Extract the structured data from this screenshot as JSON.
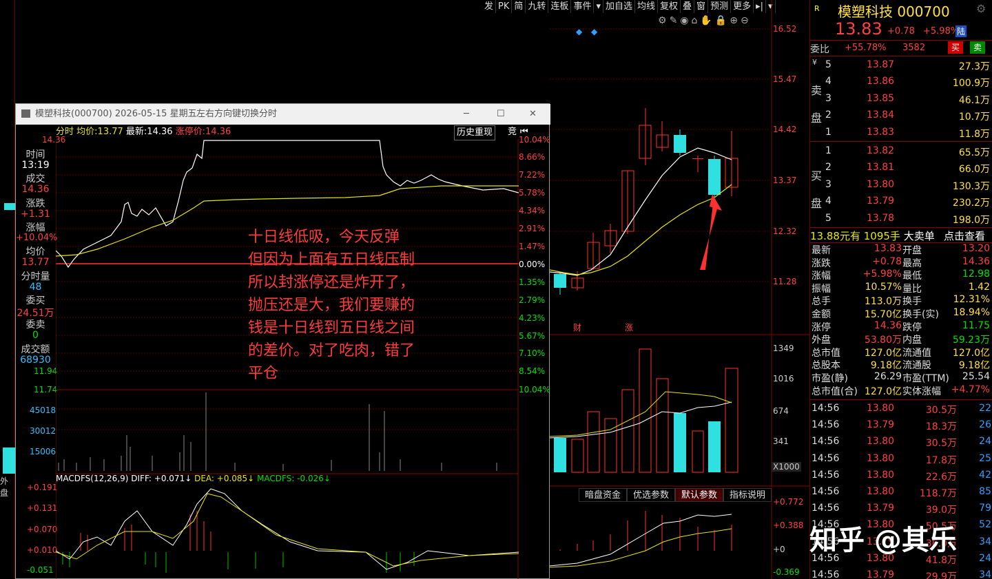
{
  "toolbar": {
    "items": [
      "发",
      "PK",
      "简",
      "九转",
      "连板",
      "事件",
      "▾",
      "加自选",
      "均线",
      "复权",
      "叠",
      "窗",
      "预测",
      "更多",
      "▸|",
      "▾"
    ]
  },
  "chart_icons": [
    "⚙",
    "✎",
    "◉",
    "⌂",
    "✋",
    "🔒",
    "⊕",
    "⊖"
  ],
  "main_axis": {
    "ticks": [
      "16.52",
      "15.47",
      "14.42",
      "13.37",
      "12.32",
      "11.28"
    ]
  },
  "event_labels": {
    "cai": "财",
    "zhang": "涨"
  },
  "volume_axis": {
    "ticks": [
      "1349",
      "1016",
      "674",
      "341"
    ],
    "unit": "X1000"
  },
  "indicator_tabs": [
    "暗盘资金",
    "优选参数",
    "默认参数",
    "指标说明"
  ],
  "macd_axis_right": {
    "ticks": [
      "+0.772",
      "+0.388",
      "+0",
      "-0.369"
    ]
  },
  "popup": {
    "title": "模塑科技(000700) 2026-05-15 星期五",
    "hint": "左右方向键切换分时",
    "min_label": "─",
    "max_label": "☐",
    "close_label": "✕",
    "bar": {
      "a": "分时",
      "b": "均价:",
      "avg": "13.77",
      "c": "最新:",
      "latest": "14.36",
      "d": "涨停价:",
      "limit": "14.36",
      "history": "历史重现",
      "bid": "竞"
    },
    "left_top_price": "14.36",
    "side": {
      "time_label": "时间",
      "time": "13:19",
      "deal_label": "成交",
      "deal": "14.36",
      "chg_label": "涨跌",
      "chg": "+1.31",
      "pct_label": "涨幅",
      "pct": "+10.04%",
      "avg_label": "均价",
      "avg": "13.77",
      "vol_label": "分时量",
      "vol": "48",
      "buy_label": "委买",
      "buy": "24.51万",
      "sell_label": "委卖",
      "sell": "0",
      "amt_label": "成交额",
      "amt": "68930"
    },
    "left_prices": [
      "11.94",
      "11.74"
    ],
    "right_pct": [
      "10.04%",
      "8.66%",
      "7.22%",
      "5.78%",
      "4.34%",
      "2.91%",
      "1.47%",
      "0.00%",
      "1.35%",
      "2.79%",
      "4.23%",
      "5.67%",
      "7.10%",
      "8.54%",
      "10.04%"
    ],
    "vol_ticks": [
      "45018",
      "30012",
      "15006"
    ],
    "macd_title": "MACDFS(12,26,9)",
    "diff": "DIFF: +0.071↓",
    "dea": "DEA: +0.085↓",
    "macdfs": "MACDFS: -0.026↓",
    "macd_ticks": [
      "+0.191",
      "+0.131",
      "+0.070",
      "+0.010",
      "-0.051"
    ]
  },
  "note": "十日线低吸，今天反弹\n但因为上面有五日线压制\n所以封涨停还是炸开了，\n抛压还是大，我们要赚的\n钱是十日线到五日线之间\n的差价。对了吃肉，错了\n平仓",
  "left_partial": {
    "label": "外盘"
  },
  "right_panel": {
    "r_badge": "R",
    "name": "模塑科技",
    "code": "000700",
    "price": "13.83",
    "chg": "+0.78",
    "pct": "+5.98%",
    "lu": "陆",
    "weibi_label": "委比",
    "weibi": "+55.78%",
    "weicha": "3582",
    "buy_btn": "买",
    "sell_btn": "卖",
    "sell_side": "卖盘",
    "buy_side": "买盘",
    "yen": "¥",
    "asks": [
      [
        "5",
        "13.87",
        "27.3万"
      ],
      [
        "4",
        "13.86",
        "100.9万"
      ],
      [
        "3",
        "13.85",
        "46.1万"
      ],
      [
        "2",
        "13.84",
        "10.7万"
      ],
      [
        "1",
        "13.83",
        "11.8万"
      ]
    ],
    "bids": [
      [
        "1",
        "13.82",
        "65.5万"
      ],
      [
        "2",
        "13.81",
        "66.0万"
      ],
      [
        "3",
        "13.80",
        "130.3万"
      ],
      [
        "4",
        "13.79",
        "230.2万"
      ],
      [
        "5",
        "13.78",
        "198.0万"
      ]
    ],
    "bigorder": {
      "price": "13.88元有",
      "vol": "1095手",
      "label": "大卖单",
      "link": "点击查看"
    },
    "stats": [
      [
        "最新",
        "13.83",
        "开盘",
        "13.20"
      ],
      [
        "涨跌",
        "+0.78",
        "最高",
        "14.36"
      ],
      [
        "涨幅",
        "+5.98%",
        "最低",
        "12.98"
      ],
      [
        "振幅",
        "10.57%",
        "量比",
        "1.42"
      ],
      [
        "总手",
        "113.0万",
        "换手",
        "12.31%"
      ],
      [
        "金额",
        "15.70亿",
        "换手(实)",
        "18.94%"
      ],
      [
        "涨停",
        "14.36",
        "跌停",
        "11.75"
      ],
      [
        "外盘",
        "53.80万",
        "内盘",
        "59.23万"
      ],
      [
        "总市值",
        "127.0亿",
        "流通值",
        "127.0亿"
      ],
      [
        "总股本",
        "9.18亿",
        "流通股",
        "9.18亿"
      ],
      [
        "市盈(静)",
        "26.29",
        "市盈(TTM)",
        "25.54"
      ],
      [
        "总市值(合)",
        "127.0亿",
        "实体涨幅",
        "+4.77%"
      ]
    ],
    "ticks": [
      [
        "14:56",
        "13.80",
        "30.5万",
        "22"
      ],
      [
        "14:56",
        "13.79",
        "18.3万",
        "26"
      ],
      [
        "14:56",
        "13.80",
        "30.5万",
        "24"
      ],
      [
        "14:56",
        "13.80",
        "17.8万",
        "25"
      ],
      [
        "14:56",
        "13.80",
        "22.6万",
        "42"
      ],
      [
        "14:56",
        "13.80",
        "118.7万",
        "85"
      ],
      [
        "14:56",
        "13.79",
        "39.0万",
        "79"
      ],
      [
        "14:56",
        "13.80",
        "50.5万",
        "52"
      ],
      [
        "14:56",
        "13.79",
        "36.0万",
        "34"
      ],
      [
        "14:56",
        "13.80",
        "41.8万",
        "24"
      ],
      [
        "14:56",
        "13.79",
        "29.9万",
        "34"
      ]
    ]
  },
  "watermark": "知乎 @其乐"
}
